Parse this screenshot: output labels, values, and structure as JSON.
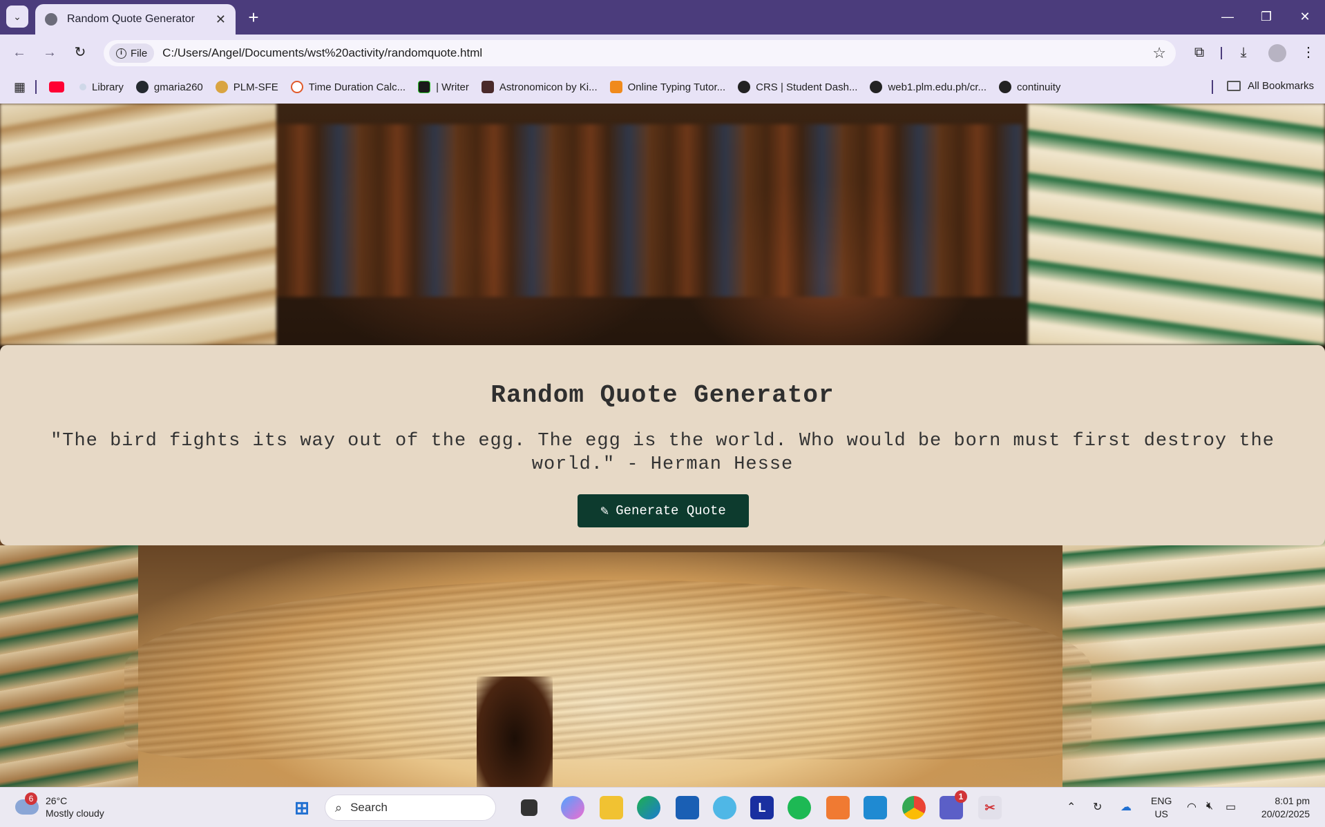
{
  "browser": {
    "tab_title": "Random Quote Generator",
    "address_chip": "File",
    "url": "C:/Users/Angel/Documents/wst%20activity/randomquote.html"
  },
  "bookmarks": {
    "items": [
      {
        "label": "Library",
        "color": "#cfd8e8"
      },
      {
        "label": "gmaria260",
        "color": "#24292f"
      },
      {
        "label": "PLM-SFE",
        "color": "#d9a441"
      },
      {
        "label": "Time Duration Calc...",
        "color": "#e05a2b"
      },
      {
        "label": "| Writer",
        "color": "#1a1a1a"
      },
      {
        "label": "Astronomicon by Ki...",
        "color": "#4a2a2a"
      },
      {
        "label": "Online Typing Tutor...",
        "color": "#f08a1c"
      },
      {
        "label": "CRS | Student Dash...",
        "color": "#222222"
      },
      {
        "label": "web1.plm.edu.ph/cr...",
        "color": "#222222"
      },
      {
        "label": "continuity",
        "color": "#222222"
      }
    ],
    "all_label": "All Bookmarks"
  },
  "page": {
    "heading": "Random Quote Generator",
    "quote": "\"The bird fights its way out of the egg. The egg is the world. Who would be born must first destroy the world.\" - Herman Hesse",
    "button_label": "Generate Quote",
    "button_color": "#0d3b2e",
    "card_color": "#e7d9c6"
  },
  "taskbar": {
    "weather_temp": "26°C",
    "weather_desc": "Mostly cloudy",
    "weather_badge": "6",
    "search_placeholder": "Search",
    "teams_badge": "1",
    "lang_top": "ENG",
    "lang_bottom": "US",
    "time": "8:01 pm",
    "date": "20/02/2025"
  }
}
